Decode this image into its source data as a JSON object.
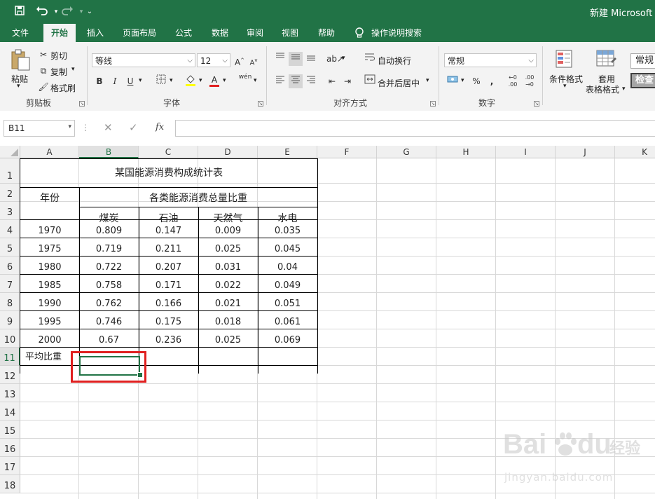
{
  "titlebar": {
    "title": "新建 Microsoft E",
    "save_icon": "save-icon",
    "undo_icon": "undo-icon",
    "redo_icon": "redo-icon",
    "customize_icon": "chevron-down-icon"
  },
  "tabs": [
    {
      "label": "文件"
    },
    {
      "label": "开始"
    },
    {
      "label": "插入"
    },
    {
      "label": "页面布局"
    },
    {
      "label": "公式"
    },
    {
      "label": "数据"
    },
    {
      "label": "审阅"
    },
    {
      "label": "视图"
    },
    {
      "label": "帮助"
    }
  ],
  "tell_me": "操作说明搜索",
  "ribbon": {
    "clipboard": {
      "label": "剪贴板",
      "paste": "粘贴",
      "cut": "剪切",
      "copy": "复制",
      "format_painter": "格式刷"
    },
    "font": {
      "label": "字体",
      "font_name": "等线",
      "font_size": "12",
      "bold": "B",
      "italic": "I",
      "underline": "U",
      "font_color_glyph": "A",
      "phonetic": "wén"
    },
    "alignment": {
      "label": "对齐方式",
      "wrap_text": "自动换行",
      "merge_center": "合并后居中"
    },
    "number": {
      "label": "数字",
      "format": "常规"
    },
    "styles": {
      "conditional_format": "条件格式",
      "format_as_table_1": "套用",
      "format_as_table_2": "表格格式",
      "cell_style_normal": "常规",
      "cell_style_check": "检查"
    }
  },
  "formula_bar": {
    "name_box": "B11",
    "fx": "fx",
    "formula": ""
  },
  "columns": [
    "A",
    "B",
    "C",
    "D",
    "E",
    "F",
    "G",
    "H",
    "I",
    "J",
    "K"
  ],
  "rows": [
    "1",
    "2",
    "3",
    "4",
    "5",
    "6",
    "7",
    "8",
    "9",
    "10",
    "11",
    "12",
    "13",
    "14",
    "15",
    "16",
    "17",
    "18"
  ],
  "selected_cell": {
    "col": "B",
    "row": "11"
  },
  "sheet": {
    "title": "某国能源消费构成统计表",
    "year_header": "年份",
    "ratio_header": "各类能源消费总量比重",
    "categories": [
      "煤炭",
      "石油",
      "天然气",
      "水电"
    ],
    "data": [
      {
        "year": "1970",
        "values": [
          "0.809",
          "0.147",
          "0.009",
          "0.035"
        ]
      },
      {
        "year": "1975",
        "values": [
          "0.719",
          "0.211",
          "0.025",
          "0.045"
        ]
      },
      {
        "year": "1980",
        "values": [
          "0.722",
          "0.207",
          "0.031",
          "0.04"
        ]
      },
      {
        "year": "1985",
        "values": [
          "0.758",
          "0.171",
          "0.022",
          "0.049"
        ]
      },
      {
        "year": "1990",
        "values": [
          "0.762",
          "0.166",
          "0.021",
          "0.051"
        ]
      },
      {
        "year": "1995",
        "values": [
          "0.746",
          "0.175",
          "0.018",
          "0.061"
        ]
      },
      {
        "year": "2000",
        "values": [
          "0.67",
          "0.236",
          "0.025",
          "0.069"
        ]
      }
    ],
    "avg_label": "平均比重"
  },
  "watermark": {
    "brand": "Bai",
    "brand2": "du",
    "cn": "经验",
    "url": "jingyan.baidu.com"
  },
  "colors": {
    "excel_green": "#217346",
    "highlight_red": "#e02020"
  }
}
